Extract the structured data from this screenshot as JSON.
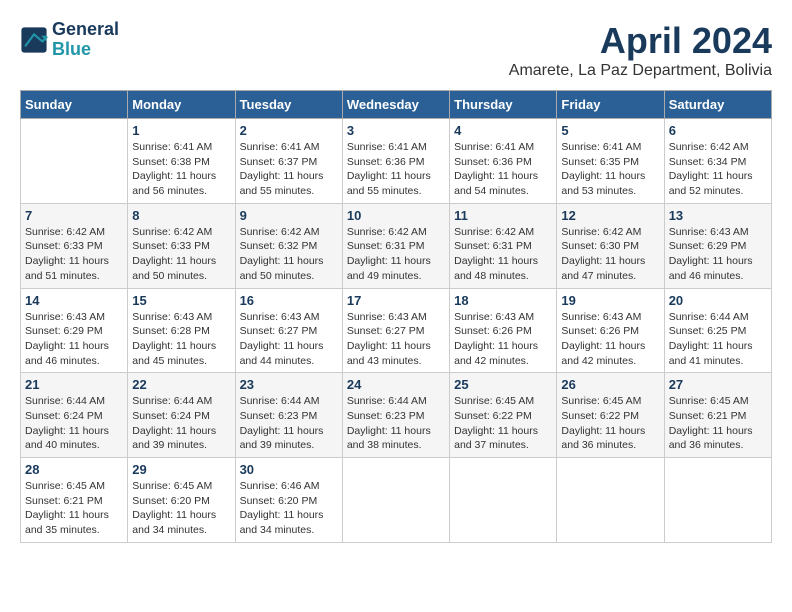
{
  "header": {
    "logo_line1": "General",
    "logo_line2": "Blue",
    "title": "April 2024",
    "subtitle": "Amarete, La Paz Department, Bolivia"
  },
  "calendar": {
    "days_of_week": [
      "Sunday",
      "Monday",
      "Tuesday",
      "Wednesday",
      "Thursday",
      "Friday",
      "Saturday"
    ],
    "weeks": [
      [
        {
          "day": "",
          "info": ""
        },
        {
          "day": "1",
          "info": "Sunrise: 6:41 AM\nSunset: 6:38 PM\nDaylight: 11 hours\nand 56 minutes."
        },
        {
          "day": "2",
          "info": "Sunrise: 6:41 AM\nSunset: 6:37 PM\nDaylight: 11 hours\nand 55 minutes."
        },
        {
          "day": "3",
          "info": "Sunrise: 6:41 AM\nSunset: 6:36 PM\nDaylight: 11 hours\nand 55 minutes."
        },
        {
          "day": "4",
          "info": "Sunrise: 6:41 AM\nSunset: 6:36 PM\nDaylight: 11 hours\nand 54 minutes."
        },
        {
          "day": "5",
          "info": "Sunrise: 6:41 AM\nSunset: 6:35 PM\nDaylight: 11 hours\nand 53 minutes."
        },
        {
          "day": "6",
          "info": "Sunrise: 6:42 AM\nSunset: 6:34 PM\nDaylight: 11 hours\nand 52 minutes."
        }
      ],
      [
        {
          "day": "7",
          "info": "Sunrise: 6:42 AM\nSunset: 6:33 PM\nDaylight: 11 hours\nand 51 minutes."
        },
        {
          "day": "8",
          "info": "Sunrise: 6:42 AM\nSunset: 6:33 PM\nDaylight: 11 hours\nand 50 minutes."
        },
        {
          "day": "9",
          "info": "Sunrise: 6:42 AM\nSunset: 6:32 PM\nDaylight: 11 hours\nand 50 minutes."
        },
        {
          "day": "10",
          "info": "Sunrise: 6:42 AM\nSunset: 6:31 PM\nDaylight: 11 hours\nand 49 minutes."
        },
        {
          "day": "11",
          "info": "Sunrise: 6:42 AM\nSunset: 6:31 PM\nDaylight: 11 hours\nand 48 minutes."
        },
        {
          "day": "12",
          "info": "Sunrise: 6:42 AM\nSunset: 6:30 PM\nDaylight: 11 hours\nand 47 minutes."
        },
        {
          "day": "13",
          "info": "Sunrise: 6:43 AM\nSunset: 6:29 PM\nDaylight: 11 hours\nand 46 minutes."
        }
      ],
      [
        {
          "day": "14",
          "info": "Sunrise: 6:43 AM\nSunset: 6:29 PM\nDaylight: 11 hours\nand 46 minutes."
        },
        {
          "day": "15",
          "info": "Sunrise: 6:43 AM\nSunset: 6:28 PM\nDaylight: 11 hours\nand 45 minutes."
        },
        {
          "day": "16",
          "info": "Sunrise: 6:43 AM\nSunset: 6:27 PM\nDaylight: 11 hours\nand 44 minutes."
        },
        {
          "day": "17",
          "info": "Sunrise: 6:43 AM\nSunset: 6:27 PM\nDaylight: 11 hours\nand 43 minutes."
        },
        {
          "day": "18",
          "info": "Sunrise: 6:43 AM\nSunset: 6:26 PM\nDaylight: 11 hours\nand 42 minutes."
        },
        {
          "day": "19",
          "info": "Sunrise: 6:43 AM\nSunset: 6:26 PM\nDaylight: 11 hours\nand 42 minutes."
        },
        {
          "day": "20",
          "info": "Sunrise: 6:44 AM\nSunset: 6:25 PM\nDaylight: 11 hours\nand 41 minutes."
        }
      ],
      [
        {
          "day": "21",
          "info": "Sunrise: 6:44 AM\nSunset: 6:24 PM\nDaylight: 11 hours\nand 40 minutes."
        },
        {
          "day": "22",
          "info": "Sunrise: 6:44 AM\nSunset: 6:24 PM\nDaylight: 11 hours\nand 39 minutes."
        },
        {
          "day": "23",
          "info": "Sunrise: 6:44 AM\nSunset: 6:23 PM\nDaylight: 11 hours\nand 39 minutes."
        },
        {
          "day": "24",
          "info": "Sunrise: 6:44 AM\nSunset: 6:23 PM\nDaylight: 11 hours\nand 38 minutes."
        },
        {
          "day": "25",
          "info": "Sunrise: 6:45 AM\nSunset: 6:22 PM\nDaylight: 11 hours\nand 37 minutes."
        },
        {
          "day": "26",
          "info": "Sunrise: 6:45 AM\nSunset: 6:22 PM\nDaylight: 11 hours\nand 36 minutes."
        },
        {
          "day": "27",
          "info": "Sunrise: 6:45 AM\nSunset: 6:21 PM\nDaylight: 11 hours\nand 36 minutes."
        }
      ],
      [
        {
          "day": "28",
          "info": "Sunrise: 6:45 AM\nSunset: 6:21 PM\nDaylight: 11 hours\nand 35 minutes."
        },
        {
          "day": "29",
          "info": "Sunrise: 6:45 AM\nSunset: 6:20 PM\nDaylight: 11 hours\nand 34 minutes."
        },
        {
          "day": "30",
          "info": "Sunrise: 6:46 AM\nSunset: 6:20 PM\nDaylight: 11 hours\nand 34 minutes."
        },
        {
          "day": "",
          "info": ""
        },
        {
          "day": "",
          "info": ""
        },
        {
          "day": "",
          "info": ""
        },
        {
          "day": "",
          "info": ""
        }
      ]
    ]
  }
}
